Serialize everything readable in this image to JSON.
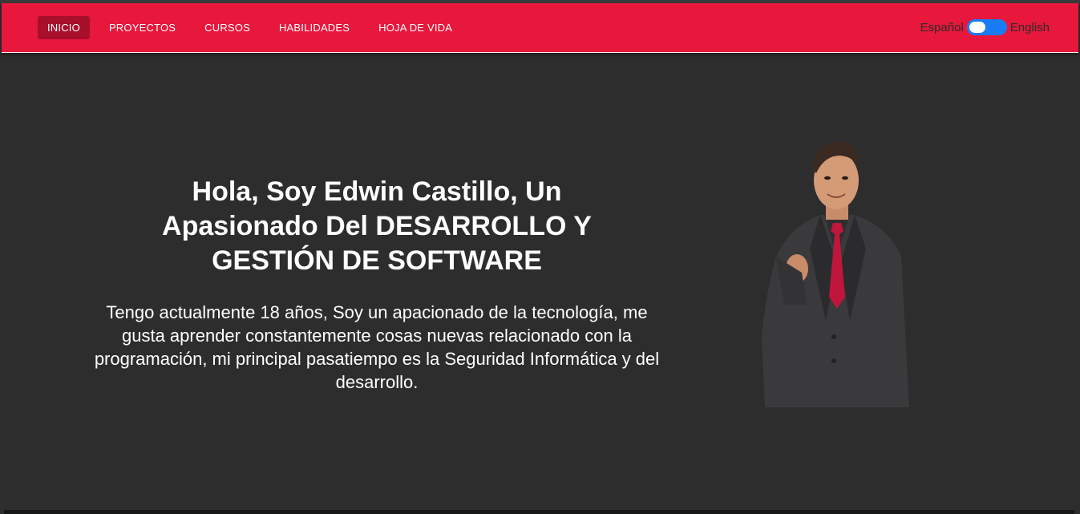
{
  "nav": {
    "items": [
      {
        "label": "INICIO",
        "active": true
      },
      {
        "label": "PROYECTOS",
        "active": false
      },
      {
        "label": "CURSOS",
        "active": false
      },
      {
        "label": "HABILIDADES",
        "active": false
      },
      {
        "label": "HOJA DE VIDA",
        "active": false
      }
    ],
    "lang_left": "Español",
    "lang_right": "English"
  },
  "hero": {
    "title": "Hola, Soy Edwin Castillo, Un Apasionado Del DESARROLLO Y GESTIÓN DE SOFTWARE",
    "description": "Tengo actualmente 18 años, Soy un apacionado de la tecnología, me gusta aprender constantemente cosas nuevas relacionado con la programación, mi principal pasatiempo es la Seguridad Informática y del desarrollo."
  },
  "colors": {
    "navbar": "#e8173c",
    "nav_active": "#a80f2b",
    "background": "#2d2d2d",
    "toggle": "#1a7cf5"
  }
}
